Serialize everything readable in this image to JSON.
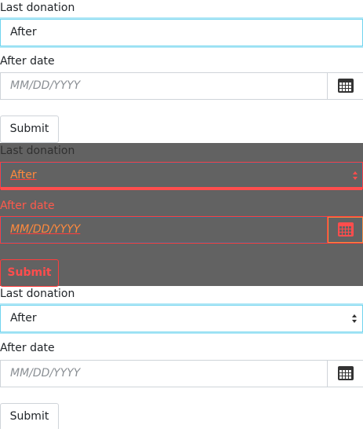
{
  "panels": [
    {
      "last_donation_label": "Last donation",
      "select_value": "After",
      "after_date_label": "After date",
      "date_placeholder": "MM/DD/YYYY",
      "submit_label": "Submit"
    },
    {
      "last_donation_label": "Last donation",
      "select_value": "After",
      "after_date_label": "After date",
      "date_placeholder": "MM/DD/YYYY",
      "submit_label": "Submit"
    },
    {
      "last_donation_label": "Last donation",
      "select_value": "After",
      "after_date_label": "After date",
      "date_placeholder": "MM/DD/YYYY",
      "submit_label": "Submit"
    }
  ],
  "icons": {
    "calendar": "calendar-icon",
    "select_caret": "chevron-updown-icon"
  },
  "colors": {
    "focus_ring": "#6fd4ee",
    "overlay_background": "#626262",
    "overlay_highlight": "#ff4d4d",
    "placeholder_text": "#8a8f94",
    "border": "#cfd4d9"
  }
}
